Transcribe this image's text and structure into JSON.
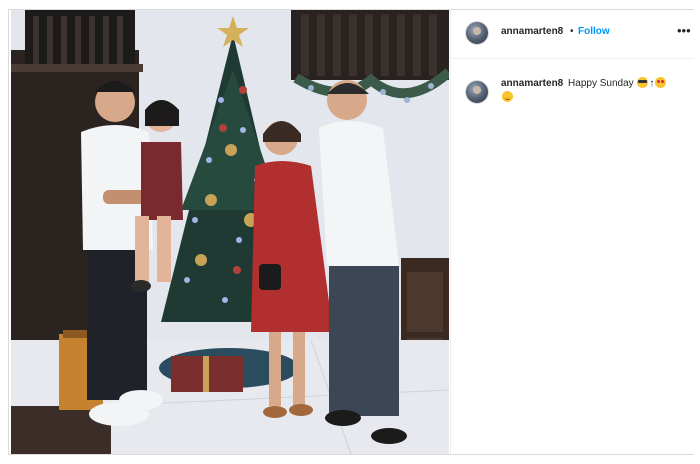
{
  "post": {
    "username": "annamarten8",
    "separator": "•",
    "follow_label": "Follow",
    "more_icon": "•••",
    "caption": {
      "username": "annamarten8",
      "text": "Happy Sunday",
      "emojis": [
        "smiling-face-with-sunglasses",
        "up-arrow",
        "smiling-face-with-heart-eyes",
        "hugging-face"
      ],
      "arrow": "↑"
    }
  },
  "colors": {
    "follow_blue": "#0095f6",
    "text": "#262626",
    "border": "#dbdbdb"
  }
}
